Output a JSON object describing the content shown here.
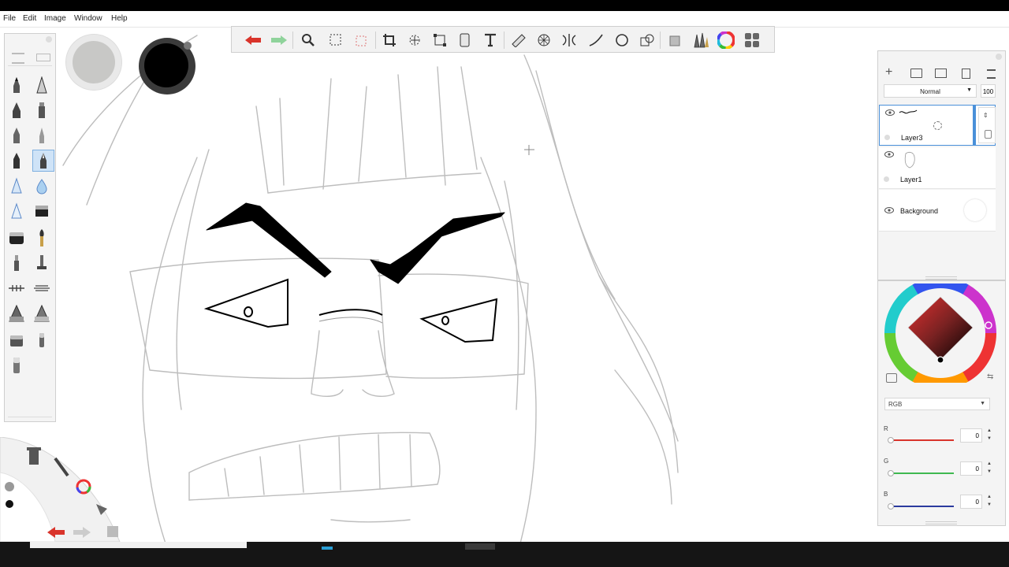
{
  "menu": {
    "file": "File",
    "edit": "Edit",
    "image": "Image",
    "window": "Window",
    "help": "Help"
  },
  "colors": {
    "accent": "#4a90d9",
    "undo_red": "#d9342b",
    "redo_green": "#3fb950",
    "current_color": "#000000",
    "secondary_color": "#c8c8c6"
  },
  "toolbar": {
    "icons": [
      "undo-icon",
      "redo-icon",
      "zoom-icon",
      "select-icon",
      "magic-wand-icon",
      "crop-icon",
      "transform-icon",
      "distort-icon",
      "symmetry-icon",
      "text-icon",
      "ruler-icon",
      "perspective-icon",
      "symmetry-brush-icon",
      "curve-icon",
      "ellipse-icon",
      "shapes-icon",
      "stamp-icon",
      "brush-library-icon",
      "color-wheel-icon",
      "panels-icon"
    ]
  },
  "layers": {
    "blend_mode": "Normal",
    "opacity": "100",
    "items": [
      {
        "name": "Layer3",
        "selected": true
      },
      {
        "name": "Layer1",
        "selected": false
      },
      {
        "name": "Background",
        "selected": false
      }
    ]
  },
  "color_panel": {
    "mode": "RGB",
    "channels": [
      {
        "label": "R",
        "value": "0",
        "color": "#d9342b"
      },
      {
        "label": "G",
        "value": "0",
        "color": "#3fb950"
      },
      {
        "label": "B",
        "value": "0",
        "color": "#2b3a9e"
      }
    ]
  }
}
